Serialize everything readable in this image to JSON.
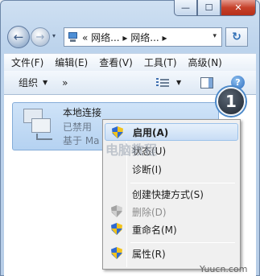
{
  "window": {
    "minimize_glyph": "—",
    "maximize_glyph": "☐",
    "close_glyph": "✕"
  },
  "nav": {
    "back_glyph": "←",
    "forward_glyph": "→",
    "dropdown_glyph": "▾",
    "address_text": "« 网络... ▸ 网络... ▸",
    "refresh_glyph": "↻"
  },
  "menubar": {
    "items": [
      "文件(F)",
      "编辑(E)",
      "查看(V)",
      "工具(T)",
      "高级(N)"
    ]
  },
  "toolbar": {
    "organize_label": "组织",
    "more_label": "»",
    "help_label": "?"
  },
  "item": {
    "name": "本地连接",
    "status": "已禁用",
    "adapter": "基于 Ma"
  },
  "context_menu": {
    "items": [
      "启用(A)",
      "状态(U)",
      "诊断(I)",
      "创建快捷方式(S)",
      "删除(D)",
      "重命名(M)",
      "属性(R)"
    ]
  },
  "step_badge": "1",
  "watermark": "电脑教程",
  "credit": "Yuucn.com",
  "colors": {
    "selection_bg": "#b5d2f1",
    "menu_highlight": "#c8ddf5",
    "close_button": "#c6412a"
  }
}
